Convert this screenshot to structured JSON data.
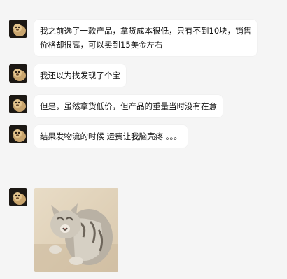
{
  "messages": [
    {
      "type": "text",
      "lines": [
        "我之前选了一款产品，拿货成本很低，只有不到10块，销售",
        "价格却很高，可以卖到15美金左右"
      ]
    },
    {
      "type": "text",
      "text": "我还以为找发现了个宝"
    },
    {
      "type": "text",
      "text": "但是，虽然拿货低价，但产品的重量当时没有在意"
    },
    {
      "type": "text",
      "text": "结果发物流的时候  运费让我脑壳疼 。。。"
    },
    {
      "type": "image",
      "image": "cat-sticker"
    }
  ]
}
